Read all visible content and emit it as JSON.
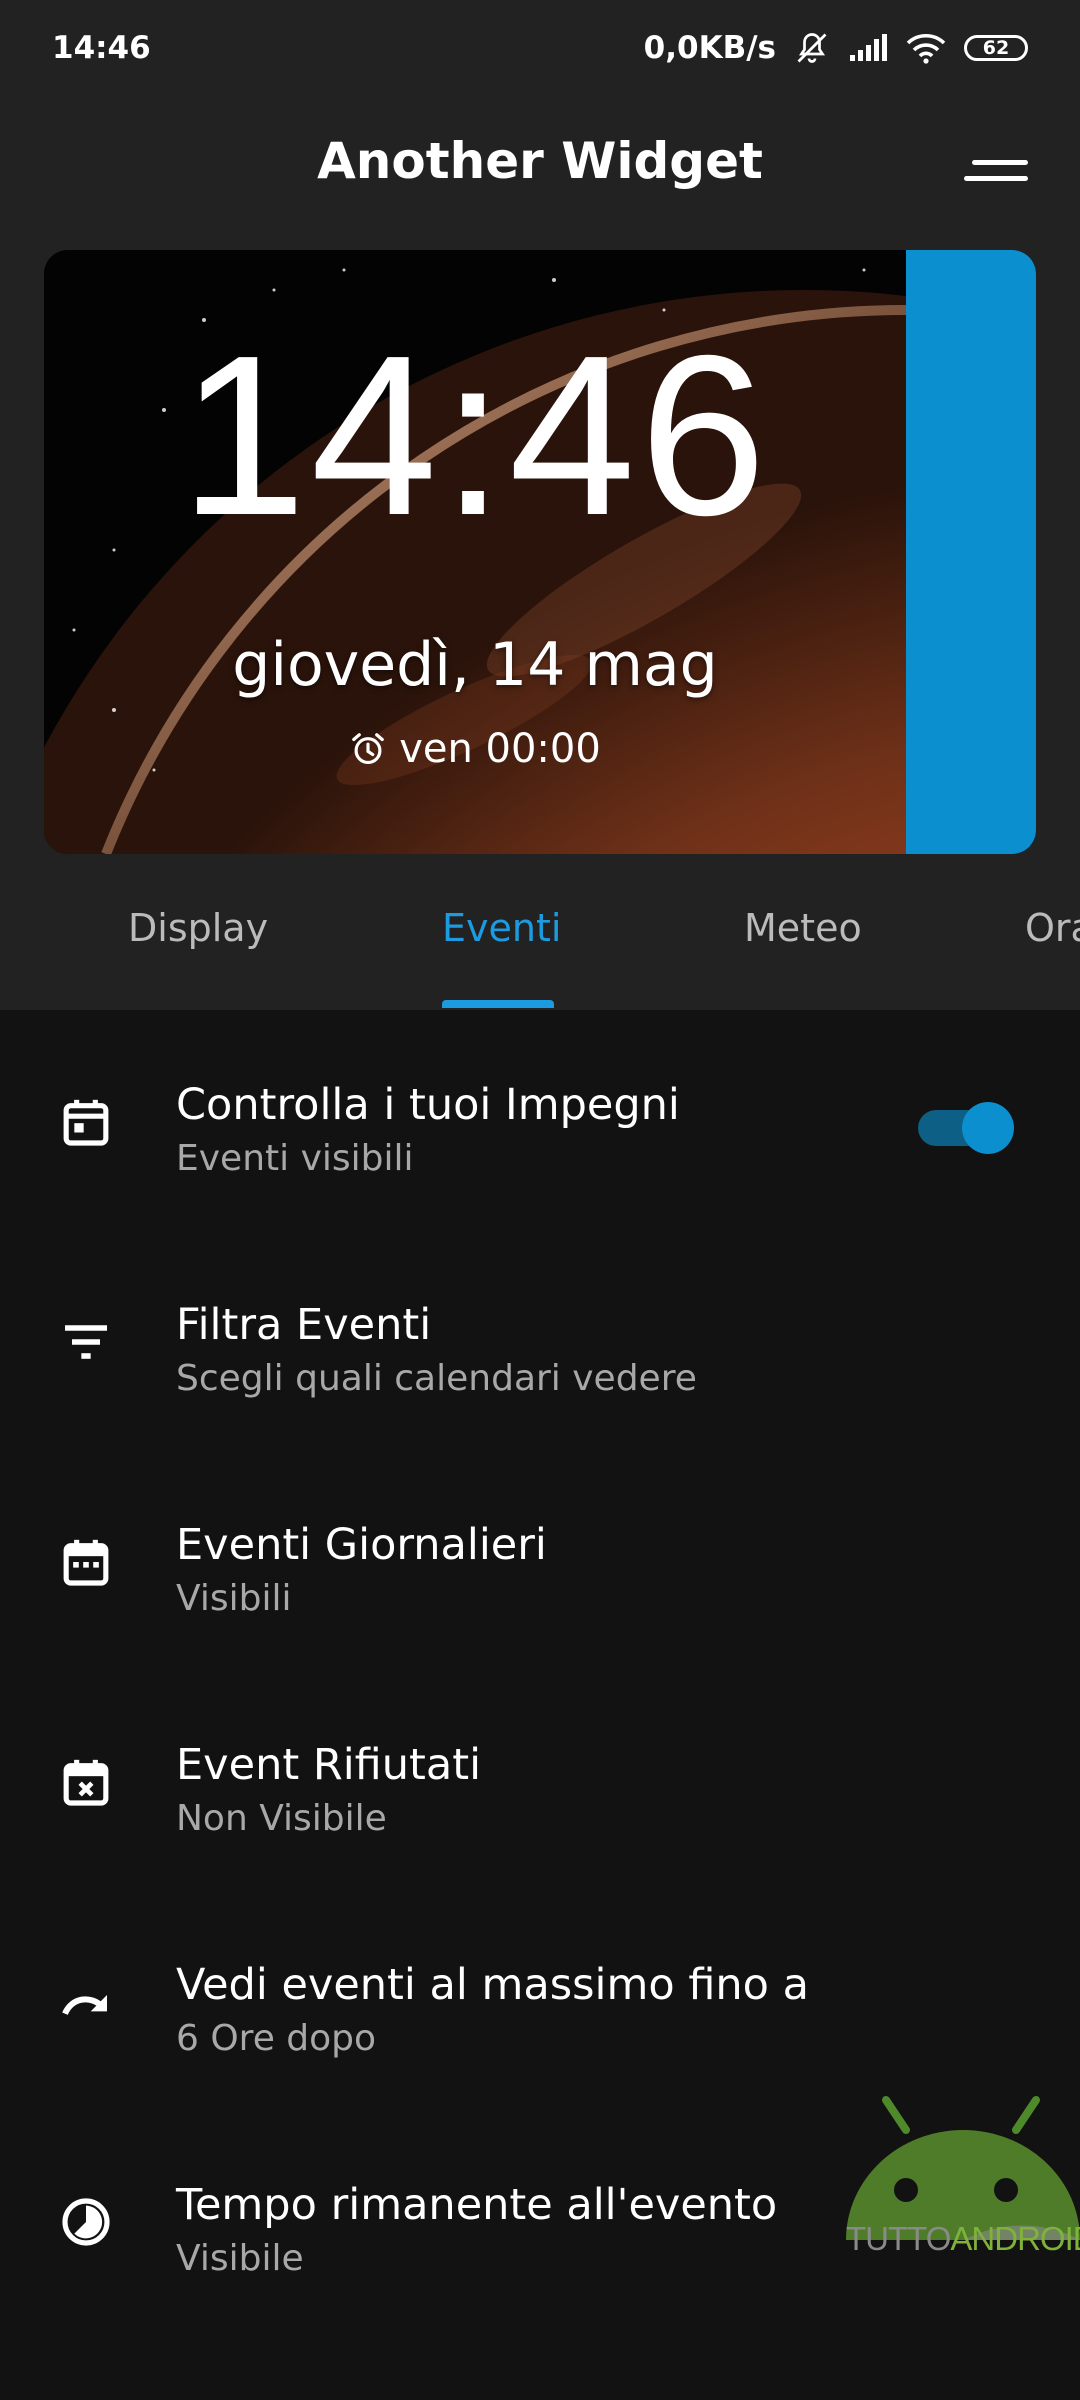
{
  "status_bar": {
    "time": "14:46",
    "net_speed": "0,0KB/s",
    "battery": "62"
  },
  "header": {
    "title": "Another Widget"
  },
  "widget": {
    "clock": "14:46",
    "date": "giovedì, 14 mag",
    "alarm": "ven 00:00",
    "accent_color": "#0b8fcf"
  },
  "tabs": [
    {
      "label": "Display"
    },
    {
      "label": "Eventi",
      "active": true
    },
    {
      "label": "Meteo"
    },
    {
      "label": "Ora"
    }
  ],
  "settings": [
    {
      "title": "Controlla i tuoi Impegni",
      "subtitle": "Eventi visibili",
      "icon": "calendar-icon",
      "toggle": true
    },
    {
      "title": "Filtra Eventi",
      "subtitle": "Scegli quali calendari vedere",
      "icon": "filter-icon"
    },
    {
      "title": "Eventi Giornalieri",
      "subtitle": "Visibili",
      "icon": "calendar-full-icon"
    },
    {
      "title": "Event Rifiutati",
      "subtitle": "Non Visibile",
      "icon": "calendar-cancel-icon"
    },
    {
      "title": "Vedi eventi al massimo fino a",
      "subtitle": "6 Ore dopo",
      "icon": "redo-arrow-icon"
    },
    {
      "title": "Tempo rimanente all'evento",
      "subtitle": "Visibile",
      "icon": "clock-progress-icon"
    }
  ],
  "watermark": {
    "part1": "TUTTO",
    "part2": "ANDROID"
  }
}
